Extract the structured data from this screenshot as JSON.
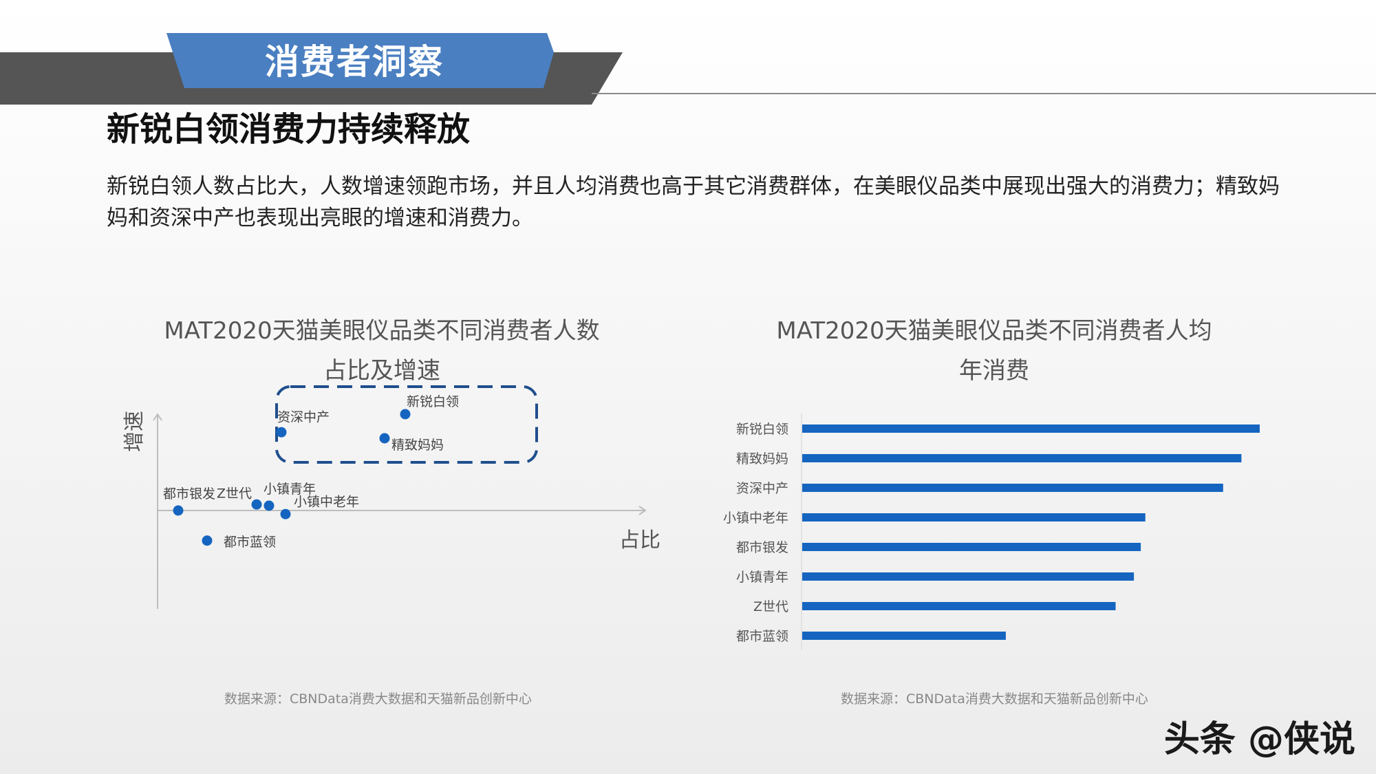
{
  "header": {
    "section_tag": "消费者洞察",
    "title": "新锐白领消费力持续释放",
    "description": "新锐白领人数占比大，人数增速领跑市场，并且人均消费也高于其它消费群体，在美眼仪品类中展现出强大的消费力；精致妈妈和资深中产也表现出亮眼的增速和消费力。"
  },
  "colors": {
    "accent_blue": "#4a7fc1",
    "bar_blue": "#1565c0",
    "dark_band": "#555555"
  },
  "chart_data": [
    {
      "type": "scatter",
      "title_line1": "MAT2020天猫美眼仪品类不同消费者人数",
      "title_line2": "占比及增速",
      "xlabel": "占比",
      "ylabel": "增速",
      "xlim": [
        0,
        10
      ],
      "ylim": [
        -3,
        10
      ],
      "points": [
        {
          "label": "新锐白领",
          "x": 6.0,
          "y": 8.0
        },
        {
          "label": "资深中产",
          "x": 3.0,
          "y": 6.5
        },
        {
          "label": "精致妈妈",
          "x": 5.5,
          "y": 6.0
        },
        {
          "label": "都市银发",
          "x": 0.5,
          "y": 0.0
        },
        {
          "label": "Z世代",
          "x": 2.4,
          "y": 0.5
        },
        {
          "label": "小镇青年",
          "x": 2.7,
          "y": 0.4
        },
        {
          "label": "小镇中老年",
          "x": 3.1,
          "y": -0.3
        },
        {
          "label": "都市蓝领",
          "x": 1.2,
          "y": -2.5
        }
      ],
      "highlight_box": [
        "新锐白领",
        "资深中产",
        "精致妈妈"
      ],
      "source": "数据来源：CBNData消费大数据和天猫新品创新中心"
    },
    {
      "type": "bar",
      "orientation": "horizontal",
      "title_line1": "MAT2020天猫美眼仪品类不同消费者人均",
      "title_line2": "年消费",
      "categories": [
        "新锐白领",
        "精致妈妈",
        "资深中产",
        "小镇中老年",
        "都市银发",
        "小镇青年",
        "Z世代",
        "都市蓝领"
      ],
      "values": [
        100,
        96,
        92,
        75,
        74,
        72.5,
        68.5,
        44.5
      ],
      "xlim": [
        0,
        100
      ],
      "source": "数据来源：CBNData消费大数据和天猫新品创新中心"
    }
  ],
  "watermark": "头条 @侠说"
}
